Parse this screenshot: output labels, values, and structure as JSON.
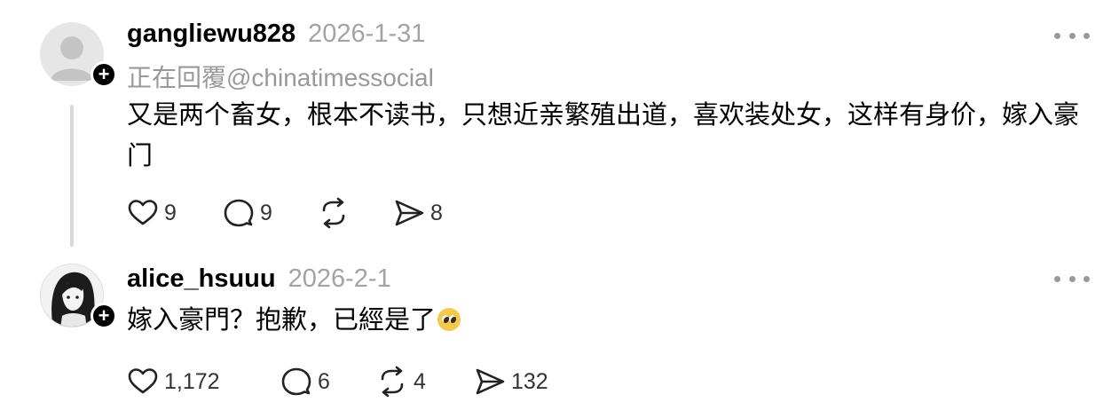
{
  "colors": {
    "background": "#ffffff",
    "text_primary": "#000000",
    "text_secondary": "#999999",
    "thread_line": "#d9d9d9"
  },
  "posts": [
    {
      "username": "gangliewu828",
      "timestamp": "2026-1-31",
      "reply_to": "正在回覆@chinatimessocial",
      "text": "又是两个畜女，根本不读书，只想近亲繁殖出道，喜欢装处女，这样有身价，嫁入豪门",
      "avatar_icon": "default-user-avatar",
      "likes": "9",
      "comments": "9",
      "reposts": "",
      "shares": "8"
    },
    {
      "username": "alice_hsuuu",
      "timestamp": "2026-2-1",
      "text": "嫁入豪門？抱歉，已經是了",
      "emoji": "pleading-face-emoji",
      "avatar_icon": "illustrated-girl-avatar",
      "likes": "1,172",
      "comments": "6",
      "reposts": "4",
      "shares": "132"
    }
  ]
}
